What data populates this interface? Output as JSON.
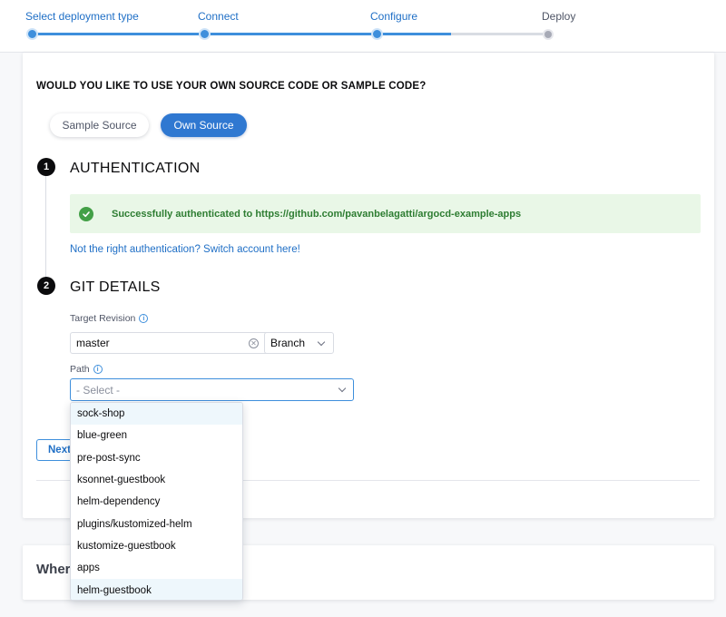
{
  "stepper": {
    "steps": [
      {
        "label": "Select deployment type",
        "state": "done"
      },
      {
        "label": "Connect",
        "state": "done"
      },
      {
        "label": "Configure",
        "state": "current"
      },
      {
        "label": "Deploy",
        "state": "todo"
      }
    ],
    "progress": 0.81
  },
  "card": {
    "question": "WOULD YOU LIKE TO USE YOUR OWN SOURCE CODE OR SAMPLE CODE?",
    "toggle": {
      "sample_label": "Sample Source",
      "own_label": "Own Source",
      "selected": "Own Source"
    },
    "auth": {
      "number": "1",
      "title": "AUTHENTICATION",
      "success_text": "Successfully authenticated to https://github.com/pavanbelagatti/argocd-example-apps",
      "switch_link": "Not the right authentication? Switch account here!"
    },
    "git": {
      "number": "2",
      "title": "GIT DETAILS",
      "target_revision_label": "Target Revision",
      "target_revision_value": "master",
      "revision_type": "Branch",
      "path_label": "Path",
      "path_placeholder": "- Select -"
    },
    "next_label": "Next"
  },
  "card2": {
    "title": "Where"
  },
  "dropdown": {
    "options": [
      "sock-shop",
      "blue-green",
      "pre-post-sync",
      "ksonnet-guestbook",
      "helm-dependency",
      "plugins/kustomized-helm",
      "kustomize-guestbook",
      "apps",
      "helm-guestbook"
    ]
  },
  "colors": {
    "accent": "#2f78d1",
    "success_bg": "#e9f7e7",
    "success_text": "#2e7d32"
  }
}
